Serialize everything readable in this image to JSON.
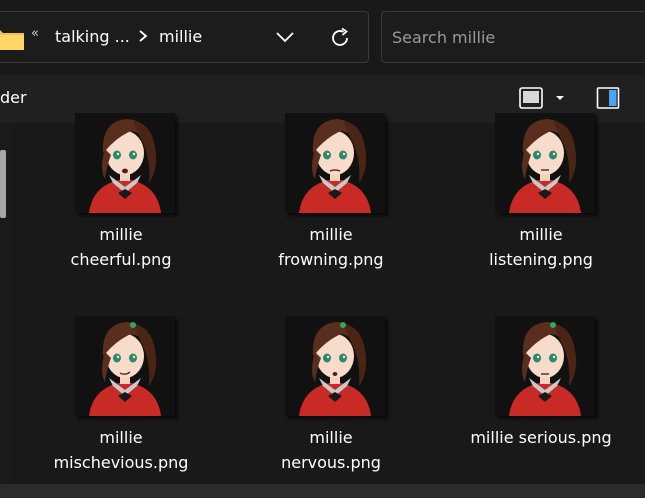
{
  "address": {
    "breadcrumbs": [
      {
        "label": "talking ..."
      },
      {
        "label": "millie"
      }
    ],
    "double_chevron": "«"
  },
  "search": {
    "placeholder": "Search millie"
  },
  "toolbar": {
    "label": "der"
  },
  "colors": {
    "background": "#191919",
    "toolbar": "#202020",
    "accent": "#4aa3f4",
    "folder": "#f3c248"
  },
  "files": [
    {
      "line1": "millie",
      "line2": "cheerful.png",
      "expression": "cheerful"
    },
    {
      "line1": "millie",
      "line2": "frowning.png",
      "expression": "frowning"
    },
    {
      "line1": "millie",
      "line2": "listening.png",
      "expression": "listening"
    },
    {
      "line1": "millie",
      "line2": "mischevious.png",
      "expression": "mischevious"
    },
    {
      "line1": "millie",
      "line2": "nervous.png",
      "expression": "nervous"
    },
    {
      "line1": "millie serious.png",
      "line2": "",
      "expression": "serious"
    }
  ]
}
